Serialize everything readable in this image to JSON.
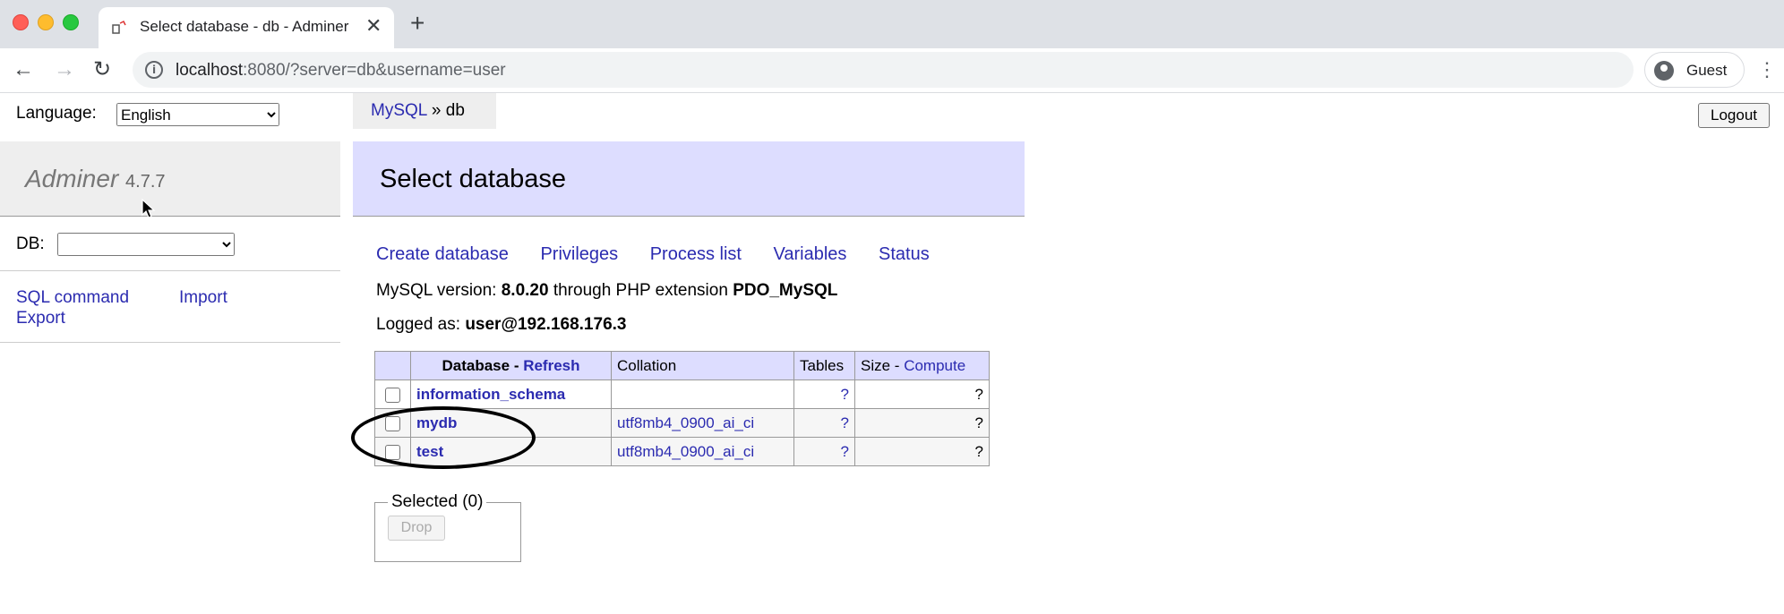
{
  "browser": {
    "tab_title": "Select database - db - Adminer",
    "tab_close": "✕",
    "new_tab": "+",
    "url_host": "localhost",
    "url_rest": ":8080/?server=db&username=user",
    "profile_label": "Guest",
    "nav_back": "←",
    "nav_forward": "→",
    "nav_reload": "↻",
    "menu": "⋮",
    "info": "i"
  },
  "sidebar": {
    "language_label": "Language:",
    "language_selected": "English",
    "brand": "Adminer",
    "version": "4.7.7",
    "db_label": "DB:",
    "db_selected": "",
    "links": {
      "sql_command": "SQL command",
      "import": "Import",
      "export": "Export"
    }
  },
  "breadcrumb": {
    "parent": "MySQL",
    "sep": " » ",
    "current": "db"
  },
  "logout_label": "Logout",
  "main": {
    "title": "Select database",
    "actions": [
      "Create database",
      "Privileges",
      "Process list",
      "Variables",
      "Status"
    ],
    "version_prefix": "MySQL version: ",
    "version_value": "8.0.20",
    "version_mid": " through PHP extension ",
    "version_ext": "PDO_MySQL",
    "logged_prefix": "Logged as: ",
    "logged_value": "user@192.168.176.3",
    "table": {
      "header_database": "Database",
      "header_dash": " - ",
      "header_refresh": "Refresh",
      "header_collation": "Collation",
      "header_tables": "Tables",
      "header_size": "Size",
      "header_compute": "Compute",
      "rows": [
        {
          "name": "information_schema",
          "collation": "",
          "tables": "?",
          "size": "?"
        },
        {
          "name": "mydb",
          "collation": "utf8mb4_0900_ai_ci",
          "tables": "?",
          "size": "?"
        },
        {
          "name": "test",
          "collation": "utf8mb4_0900_ai_ci",
          "tables": "?",
          "size": "?"
        }
      ]
    },
    "selected_legend": "Selected (0)",
    "drop_label": "Drop"
  }
}
